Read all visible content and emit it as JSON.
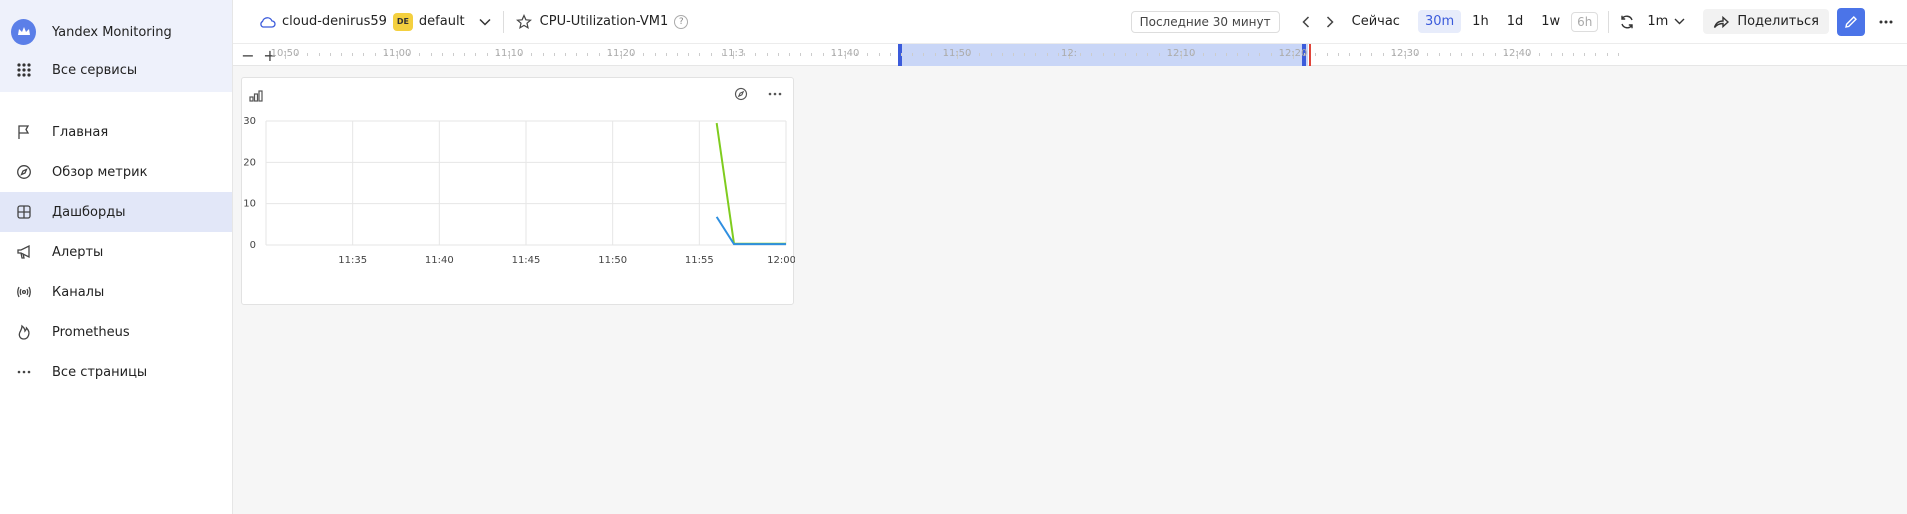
{
  "sidebar": {
    "app_title": "Yandex Monitoring",
    "all_services": "Все сервисы",
    "items": [
      {
        "label": "Главная",
        "icon": "flag-icon"
      },
      {
        "label": "Обзор метрик",
        "icon": "compass-icon"
      },
      {
        "label": "Дашборды",
        "icon": "dashboard-icon",
        "active": true
      },
      {
        "label": "Алерты",
        "icon": "megaphone-icon"
      },
      {
        "label": "Каналы",
        "icon": "broadcast-icon"
      },
      {
        "label": "Prometheus",
        "icon": "flame-icon"
      },
      {
        "label": "Все страницы",
        "icon": "ellipsis-icon"
      }
    ]
  },
  "topbar": {
    "cloud": "cloud-denirus59",
    "folder_badge": "DE",
    "folder": "default",
    "dashboard_name": "CPU-Utilization-VM1",
    "help": "?",
    "period": "Последние 30 минут",
    "now_label": "Сейчас",
    "ranges": [
      {
        "label": "30m",
        "selected": true
      },
      {
        "label": "1h"
      },
      {
        "label": "1d"
      },
      {
        "label": "1w"
      },
      {
        "label": "6h",
        "disabled": true
      }
    ],
    "refresh_interval": "1m",
    "share_label": "Поделиться",
    "accent": "#4b74e8"
  },
  "timeline": {
    "zoom_out": "−",
    "zoom_in": "+",
    "labels": [
      "10:50",
      "11:00",
      "11:10",
      "11:20",
      "11:3",
      "11:40",
      "11:50",
      "12:",
      "12:10",
      "12:20",
      "12:30",
      "12:40"
    ],
    "selection_start": "11:3",
    "selection_end": "12:"
  },
  "chart_data": {
    "type": "line",
    "title": "",
    "xlabel": "",
    "ylabel": "",
    "x_ticks": [
      "11:35",
      "11:40",
      "11:45",
      "11:50",
      "11:55",
      "12:00"
    ],
    "y_ticks": [
      0,
      10,
      20,
      30
    ],
    "ylim": [
      0,
      30
    ],
    "xlim_minutes": [
      30,
      60
    ],
    "series": [
      {
        "color": "#7fcc1f",
        "x": [
          "11:56",
          "11:57",
          "12:00"
        ],
        "y": [
          29.5,
          0.3,
          0.3
        ]
      },
      {
        "color": "#2f8fe0",
        "x": [
          "11:56",
          "11:57",
          "12:00"
        ],
        "y": [
          6.8,
          0.2,
          0.2
        ]
      }
    ]
  }
}
